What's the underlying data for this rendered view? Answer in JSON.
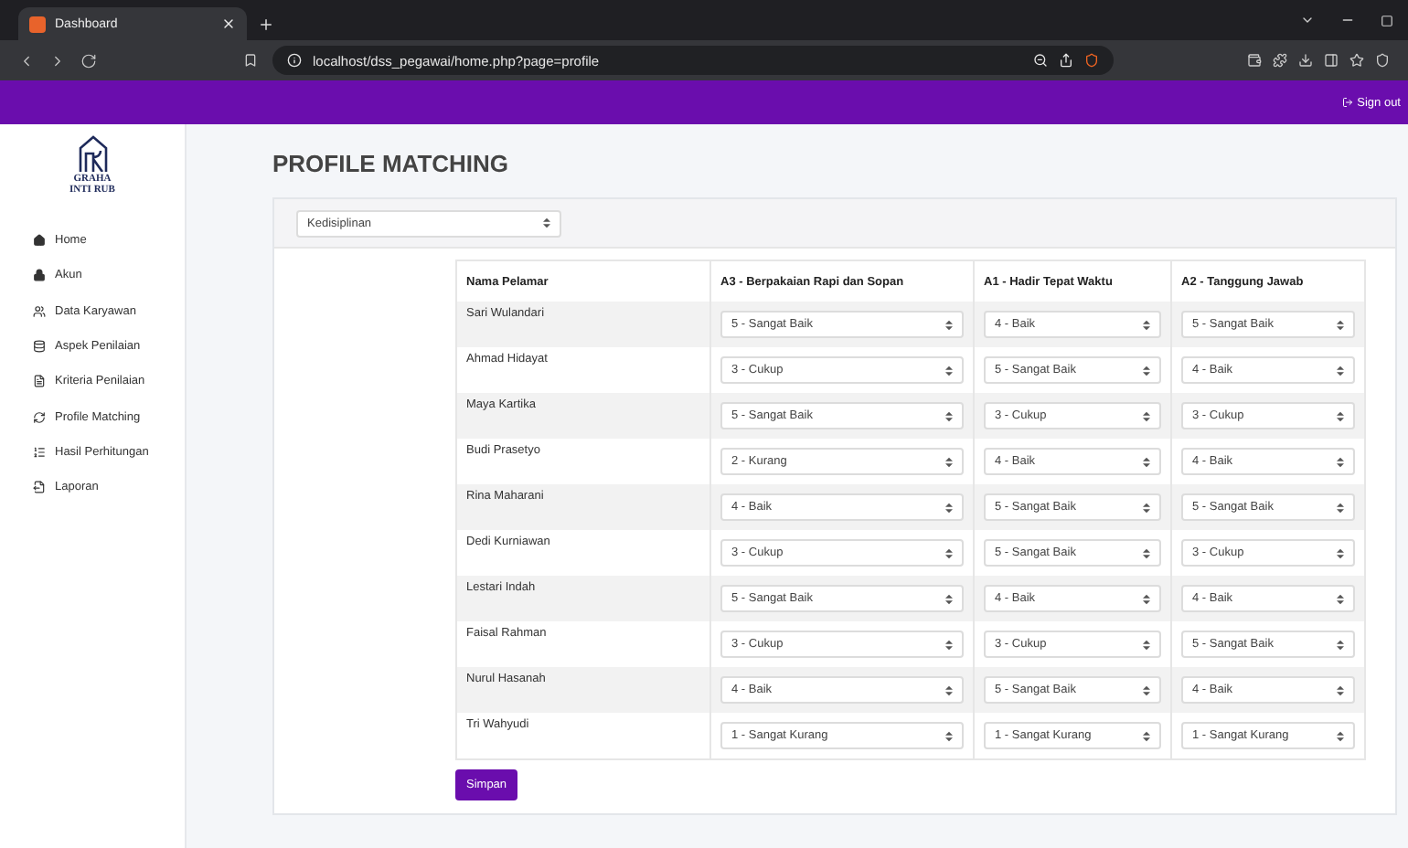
{
  "browser": {
    "tab_title": "Dashboard",
    "url": "localhost/dss_pegawai/home.php?page=profile"
  },
  "header": {
    "sign_out": "Sign out"
  },
  "logo": {
    "name": "GRAHA",
    "subname": "INTI RUB"
  },
  "sidebar": {
    "items": [
      {
        "label": "Home"
      },
      {
        "label": "Akun"
      },
      {
        "label": "Data Karyawan"
      },
      {
        "label": "Aspek Penilaian"
      },
      {
        "label": "Kriteria Penilaian"
      },
      {
        "label": "Profile Matching"
      },
      {
        "label": "Hasil Perhitungan"
      },
      {
        "label": "Laporan"
      }
    ]
  },
  "page_title": "PROFILE MATCHING",
  "filter": {
    "value": "Kedisiplinan"
  },
  "table": {
    "columns": [
      "Nama Pelamar",
      "A3 - Berpakaian Rapi dan Sopan",
      "A1 - Hadir Tepat Waktu",
      "A2 - Tanggung Jawab"
    ],
    "rows": [
      {
        "name": "Sari Wulandari",
        "values": [
          "5 - Sangat Baik",
          "4 - Baik",
          "5 - Sangat Baik"
        ]
      },
      {
        "name": "Ahmad Hidayat",
        "values": [
          "3 - Cukup",
          "5 - Sangat Baik",
          "4 - Baik"
        ]
      },
      {
        "name": "Maya Kartika",
        "values": [
          "5 - Sangat Baik",
          "3 - Cukup",
          "3 - Cukup"
        ]
      },
      {
        "name": "Budi Prasetyo",
        "values": [
          "2 - Kurang",
          "4 - Baik",
          "4 - Baik"
        ]
      },
      {
        "name": "Rina Maharani",
        "values": [
          "4 - Baik",
          "5 - Sangat Baik",
          "5 - Sangat Baik"
        ]
      },
      {
        "name": "Dedi Kurniawan",
        "values": [
          "3 - Cukup",
          "5 - Sangat Baik",
          "3 - Cukup"
        ]
      },
      {
        "name": "Lestari Indah",
        "values": [
          "5 - Sangat Baik",
          "4 - Baik",
          "4 - Baik"
        ]
      },
      {
        "name": "Faisal Rahman",
        "values": [
          "3 - Cukup",
          "3 - Cukup",
          "5 - Sangat Baik"
        ]
      },
      {
        "name": "Nurul Hasanah",
        "values": [
          "4 - Baik",
          "5 - Sangat Baik",
          "4 - Baik"
        ]
      },
      {
        "name": "Tri Wahyudi",
        "values": [
          "1 - Sangat Kurang",
          "1 - Sangat Kurang",
          "1 - Sangat Kurang"
        ]
      }
    ]
  },
  "save_button": "Simpan"
}
